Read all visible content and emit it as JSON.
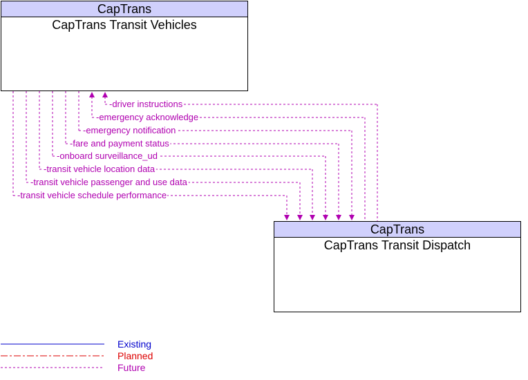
{
  "diagram": {
    "colors": {
      "future": "#b000b0",
      "existing": "#0000cc",
      "planned": "#dd0000",
      "header_fill": "#d0d0fc"
    },
    "boxes": [
      {
        "id": "vehicles",
        "owner": "CapTrans",
        "name": "CapTrans Transit Vehicles"
      },
      {
        "id": "dispatch",
        "owner": "CapTrans",
        "name": "CapTrans Transit Dispatch"
      }
    ],
    "flows": [
      {
        "label": "driver instructions",
        "direction": "to-vehicles",
        "status": "Future"
      },
      {
        "label": "emergency acknowledge",
        "direction": "to-vehicles",
        "status": "Future"
      },
      {
        "label": "emergency notification",
        "direction": "to-dispatch",
        "status": "Future"
      },
      {
        "label": "fare and payment status",
        "direction": "to-dispatch",
        "status": "Future"
      },
      {
        "label": "onboard surveillance_ud",
        "direction": "to-dispatch",
        "status": "Future"
      },
      {
        "label": "transit vehicle location data",
        "direction": "to-dispatch",
        "status": "Future"
      },
      {
        "label": "transit vehicle passenger and use data",
        "direction": "to-dispatch",
        "status": "Future"
      },
      {
        "label": "transit vehicle schedule performance",
        "direction": "to-dispatch",
        "status": "Future"
      }
    ],
    "legend": [
      {
        "label": "Existing",
        "color": "#0000cc"
      },
      {
        "label": "Planned",
        "color": "#dd0000"
      },
      {
        "label": "Future",
        "color": "#b000b0"
      }
    ]
  }
}
